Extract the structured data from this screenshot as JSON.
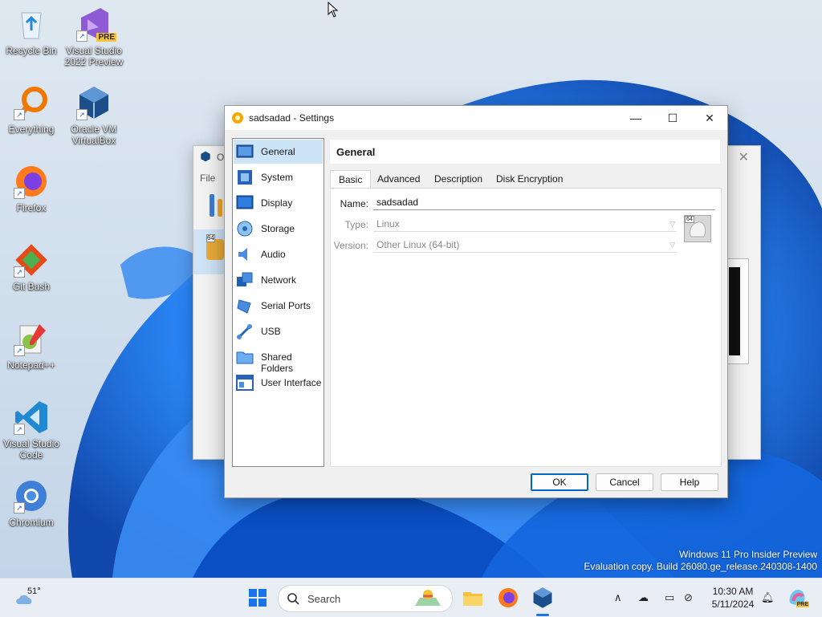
{
  "desktop_icons": [
    {
      "label": "Recycle Bin",
      "icon": "recycle-bin-icon"
    },
    {
      "label": "Visual Studio\n2022 Preview",
      "icon": "visual-studio-preview-icon",
      "badge": "PRE"
    },
    {
      "label": "Everything",
      "icon": "everything-search-icon"
    },
    {
      "label": "Oracle VM\nVirtualBox",
      "icon": "virtualbox-icon"
    },
    {
      "label": "Firefox",
      "icon": "firefox-icon"
    },
    {
      "label": "Git Bash",
      "icon": "git-bash-icon"
    },
    {
      "label": "Notepad++",
      "icon": "notepad-plus-plus-icon"
    },
    {
      "label": "Visual Studio\nCode",
      "icon": "vscode-icon"
    },
    {
      "label": "Chromium",
      "icon": "chromium-icon"
    }
  ],
  "background_window": {
    "title_fragment": "O",
    "menu_fragment": "File",
    "vm_badge": "64"
  },
  "dialog": {
    "title": "sadsadad - Settings",
    "sidebar": [
      {
        "label": "General",
        "icon": "general-icon",
        "selected": true
      },
      {
        "label": "System",
        "icon": "system-icon"
      },
      {
        "label": "Display",
        "icon": "display-icon"
      },
      {
        "label": "Storage",
        "icon": "storage-icon"
      },
      {
        "label": "Audio",
        "icon": "audio-icon"
      },
      {
        "label": "Network",
        "icon": "network-icon"
      },
      {
        "label": "Serial Ports",
        "icon": "serial-ports-icon"
      },
      {
        "label": "USB",
        "icon": "usb-icon"
      },
      {
        "label": "Shared Folders",
        "icon": "shared-folders-icon"
      },
      {
        "label": "User Interface",
        "icon": "user-interface-icon"
      }
    ],
    "page_title": "General",
    "tabs": [
      "Basic",
      "Advanced",
      "Description",
      "Disk Encryption"
    ],
    "active_tab": "Basic",
    "fields": {
      "name_label": "Name:",
      "name_value": "sadsadad",
      "type_label": "Type:",
      "type_value": "Linux",
      "version_label": "Version:",
      "version_value": "Other Linux (64-bit)",
      "os_badge": "64"
    },
    "buttons": {
      "ok": "OK",
      "cancel": "Cancel",
      "help": "Help"
    }
  },
  "watermark": {
    "line1": "Windows 11 Pro Insider Preview",
    "line2": "Evaluation copy. Build 26080.ge_release.240308-1400"
  },
  "taskbar": {
    "weather_temp": "51°",
    "search_label": "Search",
    "time": "10:30 AM",
    "date": "5/11/2024",
    "copilot_badge": "PRE"
  }
}
